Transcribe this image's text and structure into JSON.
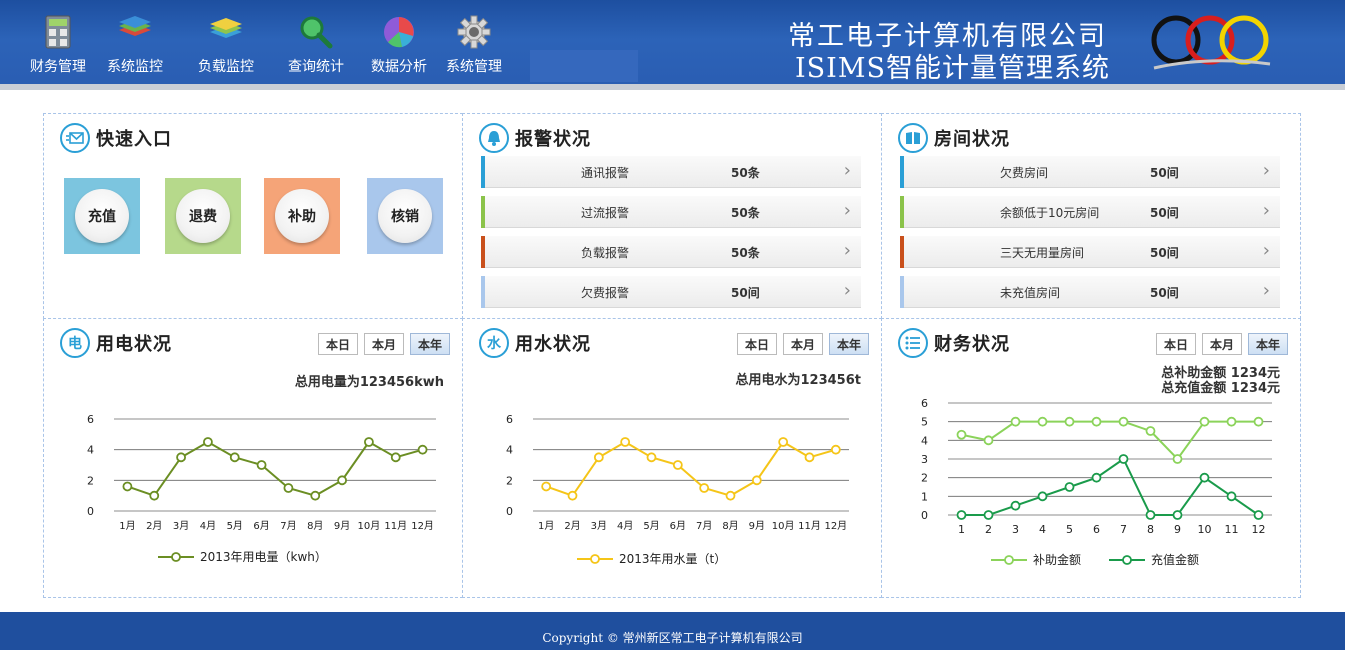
{
  "nav": [
    {
      "label": "财务管理",
      "icon": "calculator-icon"
    },
    {
      "label": "系统监控",
      "icon": "layers-icon"
    },
    {
      "label": "负载监控",
      "icon": "stack-icon"
    },
    {
      "label": "查询统计",
      "icon": "magnifier-icon"
    },
    {
      "label": "数据分析",
      "icon": "pie-chart-icon"
    },
    {
      "label": "系统管理",
      "icon": "gear-icon"
    }
  ],
  "brand": {
    "title": "常工电子计算机有限公司",
    "subtitle": "ISIMS智能计量管理系统",
    "logo_text": "CCC",
    "logo_colors": [
      "#111111",
      "#d81e1e",
      "#f2d400"
    ]
  },
  "quick": {
    "title": "快速入口",
    "items": [
      {
        "label": "充值",
        "color": "#7cc5df"
      },
      {
        "label": "退费",
        "color": "#b6d98b"
      },
      {
        "label": "补助",
        "color": "#f5a478"
      },
      {
        "label": "核销",
        "color": "#a9c7ec"
      }
    ]
  },
  "alarm": {
    "title": "报警状况",
    "rows": [
      {
        "name": "通讯报警",
        "count": "50条",
        "color": "#2a9fd6"
      },
      {
        "name": "过流报警",
        "count": "50条",
        "color": "#8bc34a"
      },
      {
        "name": "负载报警",
        "count": "50条",
        "color": "#c9501c"
      },
      {
        "name": "欠费报警",
        "count": "50间",
        "color": "#a9c7ec"
      }
    ]
  },
  "room": {
    "title": "房间状况",
    "rows": [
      {
        "name": "欠费房间",
        "count": "50间",
        "color": "#2a9fd6"
      },
      {
        "name": "余额低于10元房间",
        "count": "50间",
        "color": "#8bc34a"
      },
      {
        "name": "三天无用量房间",
        "count": "50间",
        "color": "#c9501c"
      },
      {
        "name": "未充值房间",
        "count": "50间",
        "color": "#a9c7ec"
      }
    ]
  },
  "toggles": [
    "本日",
    "本月",
    "本年"
  ],
  "electric": {
    "title": "用电状况",
    "icon_char": "电",
    "total": "总用电量为123456kwh"
  },
  "water": {
    "title": "用水状况",
    "icon_char": "水",
    "total": "总用电水为123456t"
  },
  "finance": {
    "title": "财务状况",
    "total1": "总补助金额 1234元",
    "total2": "总充值金额 1234元"
  },
  "chart_data": [
    {
      "type": "line",
      "categories": [
        "1月",
        "2月",
        "3月",
        "4月",
        "5月",
        "6月",
        "7月",
        "8月",
        "9月",
        "10月",
        "11月",
        "12月"
      ],
      "series": [
        {
          "name": "2013年用电量（kwh）",
          "values": [
            1.6,
            1.0,
            3.5,
            4.5,
            3.5,
            3.0,
            1.5,
            1.0,
            2.0,
            4.5,
            3.5,
            4.0
          ],
          "color": "#6b8e23"
        }
      ],
      "ylim": [
        0,
        6
      ],
      "yticks": [
        0,
        2,
        4,
        6
      ],
      "grid": true,
      "legend": "bottom"
    },
    {
      "type": "line",
      "categories": [
        "1月",
        "2月",
        "3月",
        "4月",
        "5月",
        "6月",
        "7月",
        "8月",
        "9月",
        "10月",
        "11月",
        "12月"
      ],
      "series": [
        {
          "name": "2013年用水量（t）",
          "values": [
            1.6,
            1.0,
            3.5,
            4.5,
            3.5,
            3.0,
            1.5,
            1.0,
            2.0,
            4.5,
            3.5,
            4.0
          ],
          "color": "#f5c518"
        }
      ],
      "ylim": [
        0,
        6
      ],
      "yticks": [
        0,
        2,
        4,
        6
      ],
      "grid": true,
      "legend": "bottom"
    },
    {
      "type": "line",
      "categories": [
        "1",
        "2",
        "3",
        "4",
        "5",
        "6",
        "7",
        "8",
        "9",
        "10",
        "11",
        "12"
      ],
      "series": [
        {
          "name": "补助金额",
          "values": [
            4.3,
            4.0,
            5.0,
            5.0,
            5.0,
            5.0,
            5.0,
            4.5,
            3.0,
            5.0,
            5.0,
            5.0
          ],
          "color": "#8bd35a"
        },
        {
          "name": "充值金额",
          "values": [
            0,
            0,
            0.5,
            1.0,
            1.5,
            2.0,
            3.0,
            0,
            0,
            2.0,
            1.0,
            0
          ],
          "color": "#1a9b4b"
        }
      ],
      "ylim": [
        0,
        6
      ],
      "yticks": [
        0,
        1,
        2,
        3,
        4,
        5,
        6
      ],
      "grid": true,
      "legend": "bottom"
    }
  ],
  "footer": {
    "copyright": "Copyright © 常州新区常工电子计算机有限公司"
  }
}
